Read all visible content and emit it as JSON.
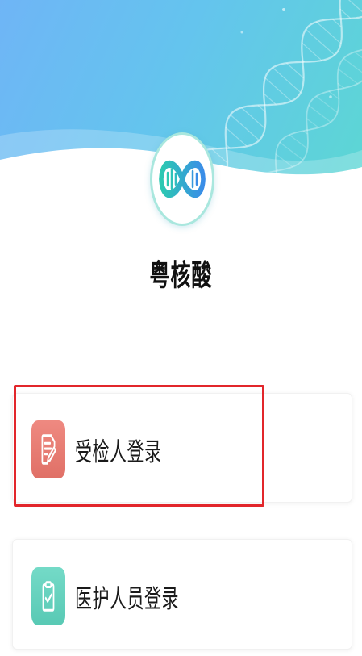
{
  "app": {
    "name": "粤核酸"
  },
  "logo": {
    "icon": "dna-infinity-logo-icon",
    "color_start": "#2cc9b1",
    "color_end": "#3a8de8"
  },
  "login_options": [
    {
      "label": "受检人登录",
      "icon": "document-edit-icon",
      "icon_color": "#ec766c",
      "highlighted": true
    },
    {
      "label": "医护人员登录",
      "icon": "clipboard-check-icon",
      "icon_color": "#5dd4be",
      "highlighted": false
    }
  ],
  "theme": {
    "header_gradient_start": "#6fb5f6",
    "header_gradient_end": "#5cd7d3",
    "highlight_color": "#e2262b"
  }
}
